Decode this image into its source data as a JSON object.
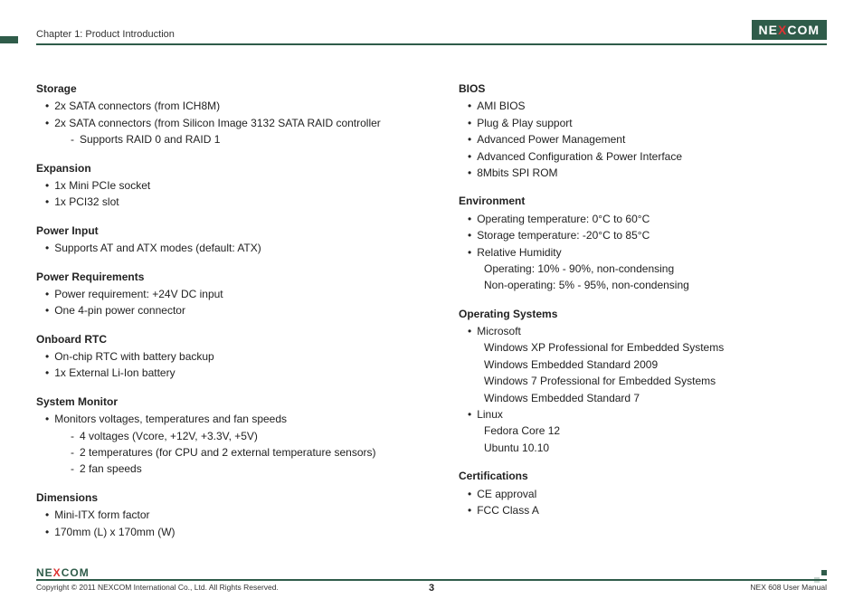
{
  "header": {
    "chapter": "Chapter 1: Product Introduction",
    "logo_pre": "NE",
    "logo_x": "X",
    "logo_post": "COM"
  },
  "left": [
    {
      "title": "Storage",
      "items": [
        {
          "t": "2x SATA connectors (from ICH8M)"
        },
        {
          "t": "2x SATA connectors (from Silicon Image 3132 SATA RAID controller"
        },
        {
          "t": "Supports RAID 0 and RAID 1",
          "cls": "sub sub-dash"
        }
      ]
    },
    {
      "title": "Expansion",
      "items": [
        {
          "t": "1x Mini PCIe socket"
        },
        {
          "t": "1x PCI32 slot"
        }
      ]
    },
    {
      "title": "Power Input",
      "items": [
        {
          "t": "Supports AT and ATX modes (default: ATX)"
        }
      ]
    },
    {
      "title": "Power Requirements",
      "items": [
        {
          "t": "Power requirement: +24V DC input"
        },
        {
          "t": "One 4-pin power connector"
        }
      ]
    },
    {
      "title": "Onboard RTC",
      "items": [
        {
          "t": "On-chip RTC with battery backup"
        },
        {
          "t": "1x External Li-Ion battery"
        }
      ]
    },
    {
      "title": "System Monitor",
      "items": [
        {
          "t": "Monitors voltages, temperatures and fan speeds"
        },
        {
          "t": "4 voltages (Vcore, +12V, +3.3V, +5V)",
          "cls": "sub sub-dash"
        },
        {
          "t": "2 temperatures (for CPU and 2 external temperature sensors)",
          "cls": "sub sub-dash"
        },
        {
          "t": "2 fan speeds",
          "cls": "sub sub-dash"
        }
      ]
    },
    {
      "title": "Dimensions",
      "items": [
        {
          "t": "Mini-ITX form factor"
        },
        {
          "t": "170mm (L) x 170mm (W)"
        }
      ]
    }
  ],
  "right": [
    {
      "title": "BIOS",
      "items": [
        {
          "t": "AMI BIOS"
        },
        {
          "t": "Plug & Play support"
        },
        {
          "t": "Advanced Power Management"
        },
        {
          "t": "Advanced Configuration & Power Interface"
        },
        {
          "t": "8Mbits SPI ROM"
        }
      ]
    },
    {
      "title": "Environment",
      "items": [
        {
          "t": "Operating temperature: 0°C to 60°C"
        },
        {
          "t": "Storage temperature: -20°C to 85°C"
        },
        {
          "t": "Relative Humidity"
        },
        {
          "t": "Operating: 10% - 90%, non-condensing",
          "cls": "plain"
        },
        {
          "t": "Non-operating: 5% - 95%, non-condensing",
          "cls": "plain"
        }
      ]
    },
    {
      "title": "Operating Systems",
      "items": [
        {
          "t": "Microsoft"
        },
        {
          "t": "Windows XP Professional for Embedded Systems",
          "cls": "plain"
        },
        {
          "t": "Windows Embedded Standard 2009",
          "cls": "plain"
        },
        {
          "t": "Windows 7 Professional for Embedded Systems",
          "cls": "plain"
        },
        {
          "t": "Windows Embedded Standard 7",
          "cls": "plain"
        },
        {
          "t": "Linux"
        },
        {
          "t": "Fedora Core 12",
          "cls": "plain"
        },
        {
          "t": "Ubuntu 10.10",
          "cls": "plain"
        }
      ]
    },
    {
      "title": "Certifications",
      "items": [
        {
          "t": "CE approval"
        },
        {
          "t": "FCC Class A"
        }
      ]
    }
  ],
  "footer": {
    "copyright": "Copyright © 2011 NEXCOM International Co., Ltd. All Rights Reserved.",
    "page": "3",
    "manual": "NEX 608 User Manual",
    "logo_pre": "NE",
    "logo_x": "X",
    "logo_post": "COM"
  }
}
